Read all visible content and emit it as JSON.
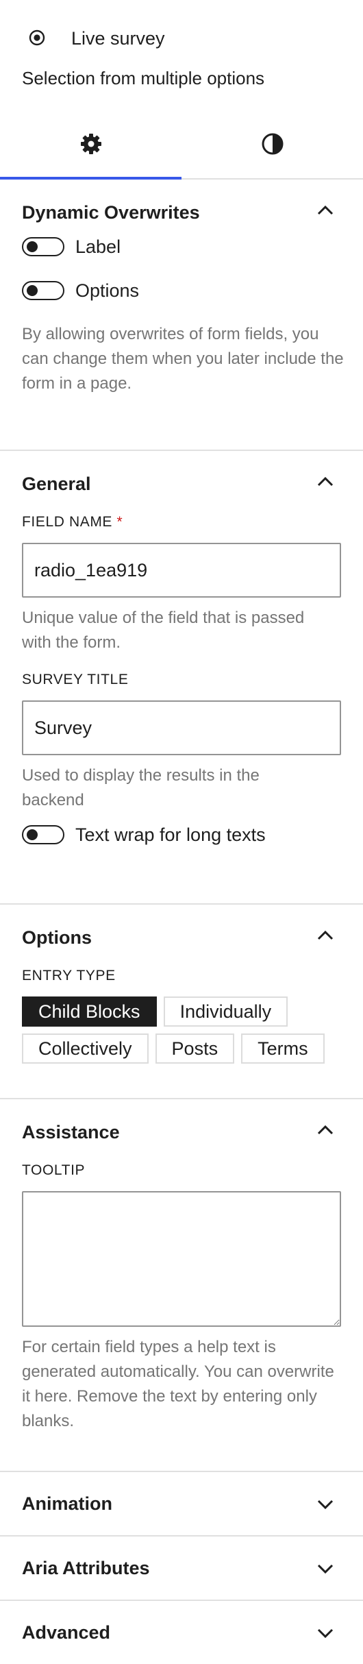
{
  "block": {
    "title": "Live survey",
    "description": "Selection from multiple options"
  },
  "tabs": [
    {
      "icon": "gear-icon",
      "active": true
    },
    {
      "icon": "contrast-icon",
      "active": false
    }
  ],
  "dynamic_overwrites": {
    "title": "Dynamic Overwrites",
    "toggles": [
      {
        "label": "Label",
        "on": false
      },
      {
        "label": "Options",
        "on": false
      }
    ],
    "help": "By allowing overwrites of form fields, you can change them when you later include the form in a page."
  },
  "general": {
    "title": "General",
    "field_name": {
      "label": "FIELD NAME",
      "required_mark": "*",
      "value": "radio_1ea919",
      "help": "Unique value of the field that is passed with the form."
    },
    "survey_title": {
      "label": "SURVEY TITLE",
      "value": "Survey",
      "help": "Used to display the results in the backend"
    },
    "text_wrap": {
      "label": "Text wrap for long texts",
      "on": false
    }
  },
  "options": {
    "title": "Options",
    "entry_type_label": "ENTRY TYPE",
    "entry_types": [
      "Child Blocks",
      "Individually",
      "Collectively",
      "Posts",
      "Terms"
    ],
    "selected": "Child Blocks"
  },
  "assistance": {
    "title": "Assistance",
    "tooltip_label": "TOOLTIP",
    "tooltip_value": "",
    "help": "For certain field types a help text is generated automatically. You can overwrite it here. Remove the text by entering only blanks."
  },
  "collapsed_sections": [
    {
      "title": "Animation"
    },
    {
      "title": "Aria Attributes"
    },
    {
      "title": "Advanced"
    }
  ]
}
